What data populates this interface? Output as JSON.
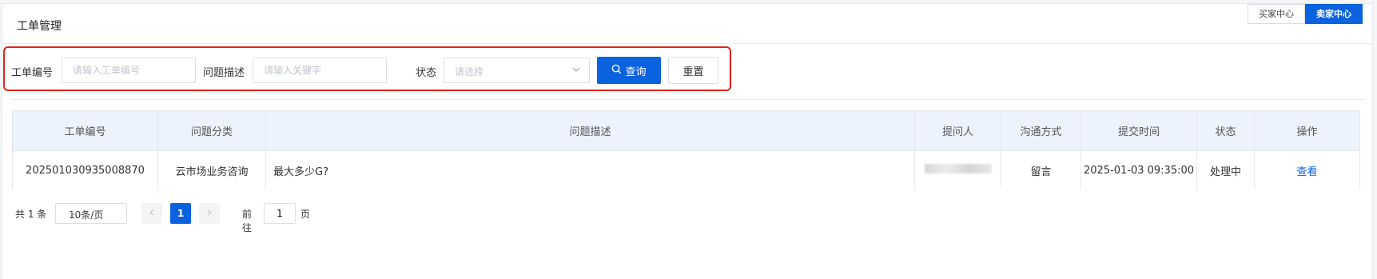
{
  "header": {
    "title": "工单管理",
    "switch": [
      "买家中心",
      "卖家中心"
    ],
    "active_switch": "卖家中心"
  },
  "filters": {
    "ticket_no_label": "工单编号",
    "ticket_no_placeholder": "请输入工单编号",
    "desc_label": "问题描述",
    "desc_placeholder": "请输入关键字",
    "status_label": "状态",
    "status_placeholder": "请选择",
    "search_label": "查询",
    "reset_label": "重置",
    "highlight_color": "#e0241b"
  },
  "table": {
    "columns": [
      "工单编号",
      "问题分类",
      "问题描述",
      "提问人",
      "沟通方式",
      "提交时间",
      "状态",
      "操作"
    ],
    "rows": [
      {
        "ticket_no": "202501030935008870",
        "category": "云市场业务咨询",
        "description": "最大多少G?",
        "asker": "",
        "channel": "留言",
        "submitted": "2025-01-03 09:35:00",
        "status": "处理中",
        "action": "查看"
      }
    ]
  },
  "pagination": {
    "total": "共 1 条",
    "page_size": "10条/页",
    "current_page": "1",
    "goto_label": "前往",
    "goto_value": "1",
    "goto_suffix": "页"
  },
  "colors": {
    "primary": "#0b62de",
    "header_bg": "#ecf3fd"
  }
}
